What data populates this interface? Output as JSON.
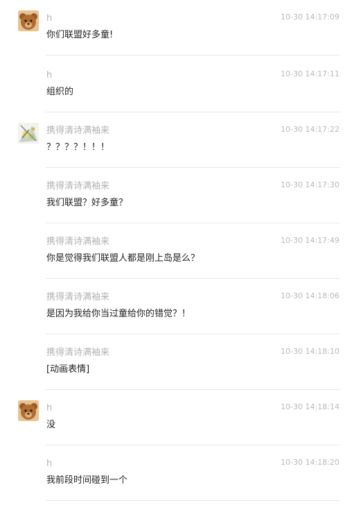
{
  "messages": [
    {
      "sender": "h",
      "time": "10-30 14:17:09",
      "text": "你们联盟好多童!",
      "avatar": "bear-avatar"
    },
    {
      "sender": "h",
      "time": "10-30 14:17:11",
      "text": "组织的",
      "avatar": ""
    },
    {
      "sender": "携得清诗满袖来",
      "time": "10-30 14:17:22",
      "text": "？？？？！！！",
      "avatar": "flower-avatar"
    },
    {
      "sender": "携得清诗满袖来",
      "time": "10-30 14:17:30",
      "text": "我们联盟？好多童？",
      "avatar": ""
    },
    {
      "sender": "携得清诗满袖来",
      "time": "10-30 14:17:49",
      "text": "你是觉得我们联盟人都是刚上岛是么？",
      "avatar": ""
    },
    {
      "sender": "携得清诗满袖来",
      "time": "10-30 14:18:06",
      "text": "是因为我给你当过童给你的错觉？！",
      "avatar": ""
    },
    {
      "sender": "携得清诗满袖来",
      "time": "10-30 14:18:10",
      "text": "[动画表情]",
      "avatar": ""
    },
    {
      "sender": "h",
      "time": "10-30 14:18:14",
      "text": "没",
      "avatar": "bear-avatar"
    },
    {
      "sender": "h",
      "time": "10-30 14:18:20",
      "text": "我前段时间碰到一个",
      "avatar": ""
    }
  ]
}
